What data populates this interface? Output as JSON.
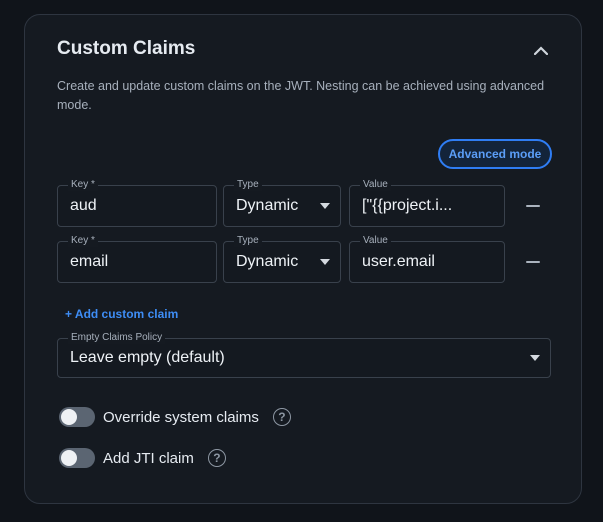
{
  "section": {
    "title": "Custom Claims",
    "description": "Create and update custom claims on the JWT. Nesting can be achieved using advanced mode.",
    "advanced_mode_label": "Advanced mode"
  },
  "claims": [
    {
      "key_label": "Key *",
      "key": "aud",
      "type_label": "Type",
      "type": "Dynamic",
      "value_label": "Value",
      "value": "[\"{{project.i..."
    },
    {
      "key_label": "Key *",
      "key": "email",
      "type_label": "Type",
      "type": "Dynamic",
      "value_label": "Value",
      "value": "user.email"
    }
  ],
  "add_custom_claim_label": "+ Add custom claim",
  "empty_claims_policy": {
    "label": "Empty Claims Policy",
    "value": "Leave empty (default)"
  },
  "toggles": [
    {
      "label": "Override system claims",
      "on": false
    },
    {
      "label": "Add JTI claim",
      "on": false
    }
  ],
  "colors": {
    "accent": "#2f7df3",
    "background": "#10141a",
    "card": "#151a21"
  }
}
